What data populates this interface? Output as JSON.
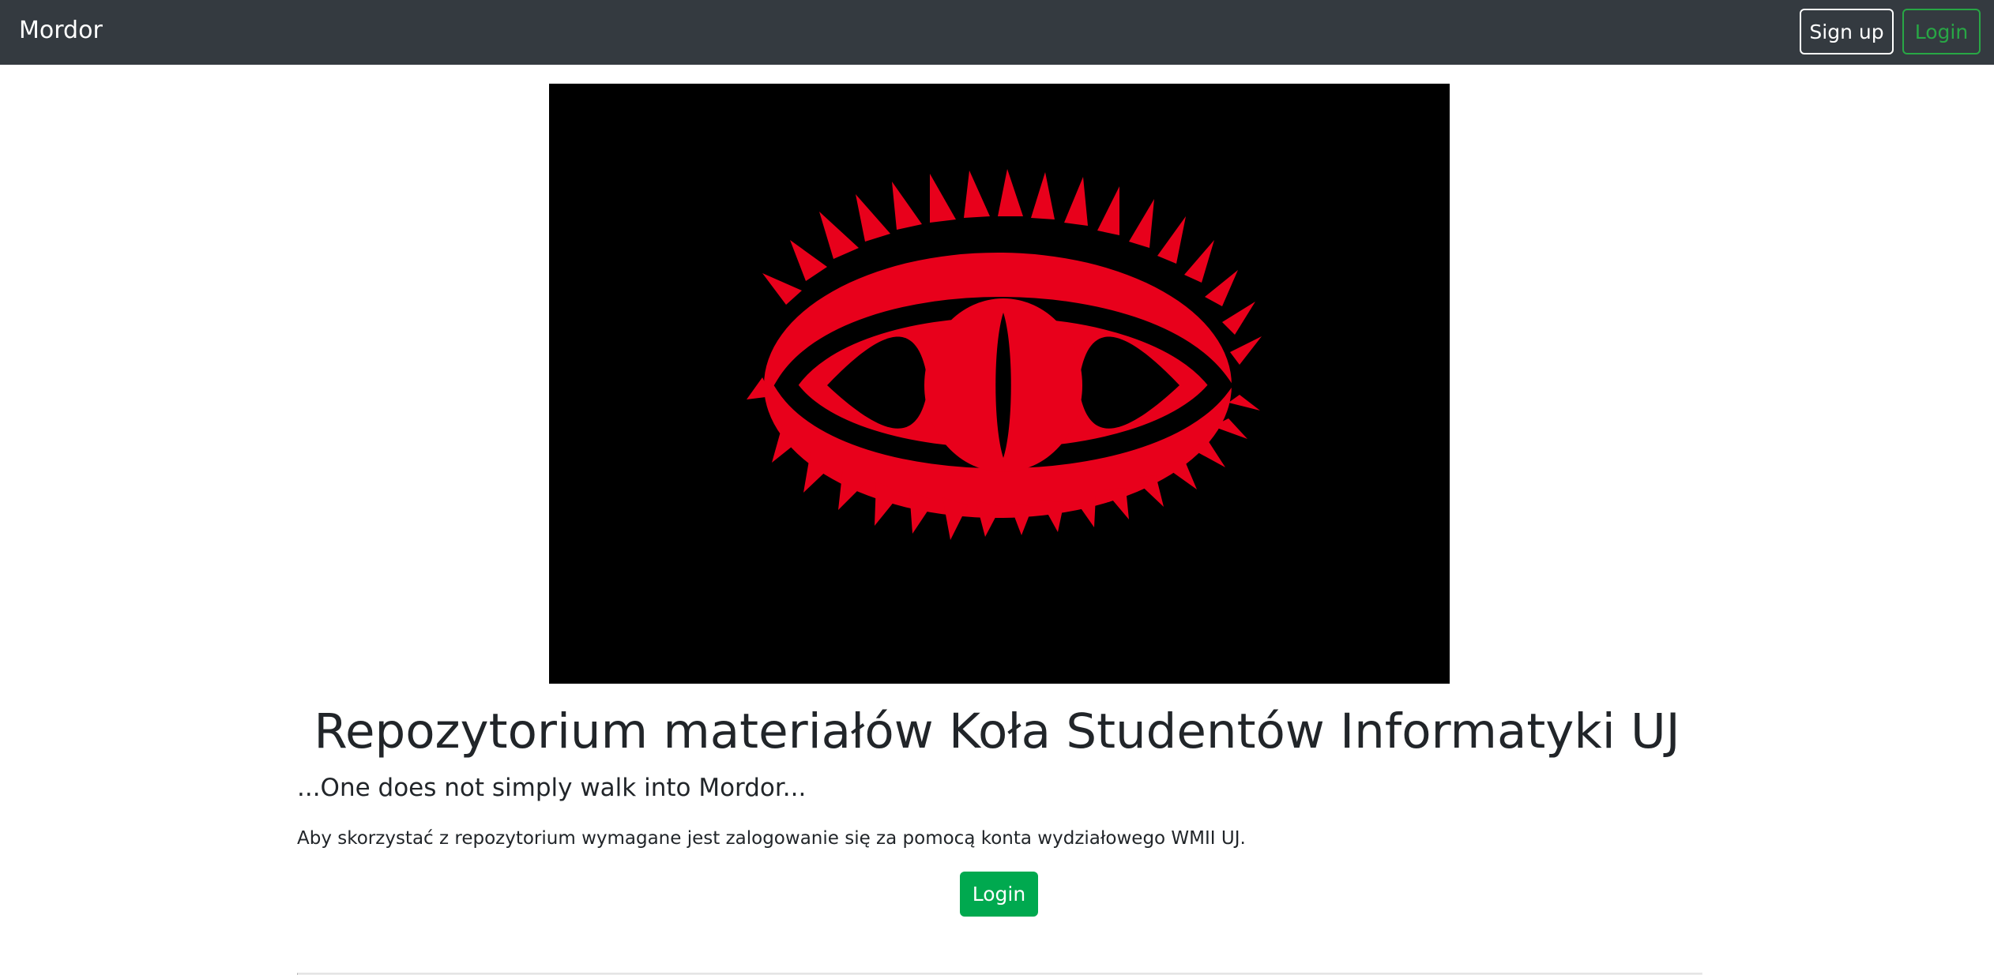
{
  "navbar": {
    "brand": "Mordor",
    "signup_label": "Sign up",
    "login_label": "Login"
  },
  "hero": {
    "image_icon": "eye-of-sauron-icon",
    "background_color": "#000000",
    "eye_color": "#e8001b"
  },
  "main": {
    "title": "Repozytorium materiałów Koła Studentów Informatyki UJ",
    "subtitle": "...One does not simply walk into Mordor...",
    "info": "Aby skorzystać z repozytorium wymagane jest zalogowanie się za pomocą konta wydziałowego WMII UJ.",
    "login_label": "Login"
  },
  "colors": {
    "navbar_bg": "#343a40",
    "success": "#28a745",
    "button_fill": "#00a94f"
  }
}
